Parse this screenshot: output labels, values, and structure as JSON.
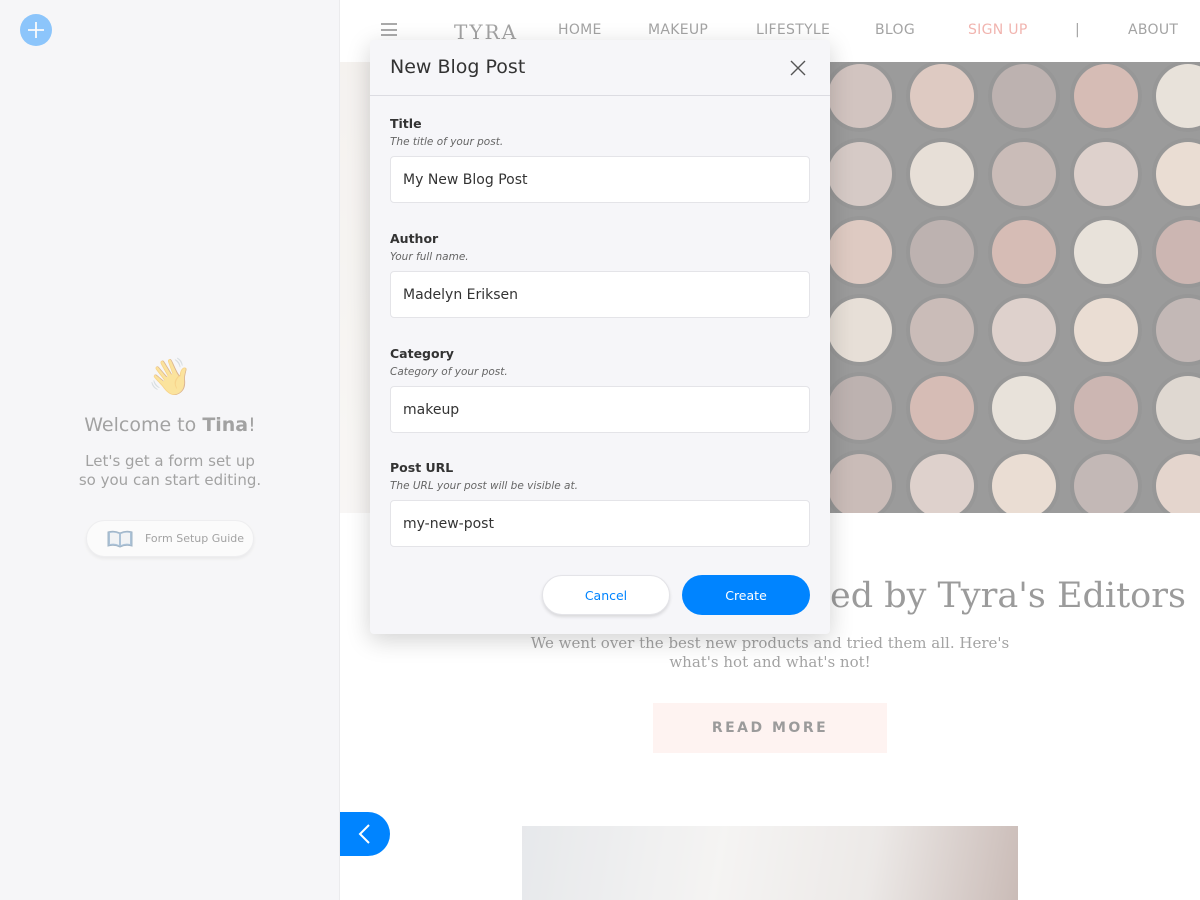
{
  "sidebar": {
    "add_icon": "plus-icon",
    "welcome_emoji": "👋",
    "welcome_prefix": "Welcome to ",
    "welcome_name": "Tina",
    "welcome_suffix": "!",
    "welcome_line1": "Let's get a form set up",
    "welcome_line2": "so you can start editing.",
    "guide_icon": "book-icon",
    "guide_label": "Form Setup Guide",
    "collapse_icon": "chevron-left-icon",
    "accent_color": "#0084ff"
  },
  "site": {
    "logo": "TYRA",
    "nav": [
      {
        "label": "HOME"
      },
      {
        "label": "MAKEUP"
      },
      {
        "label": "LIFESTYLE"
      },
      {
        "label": "BLOG"
      },
      {
        "label": "SIGN UP"
      },
      {
        "label": "|"
      },
      {
        "label": "ABOUT"
      }
    ],
    "signup_color": "#e05a4e",
    "headline_visible": "ed by Tyra's Editors",
    "blurb_line1": "We went over the best new products and tried them all. Here's",
    "blurb_line2": "what's hot and what's not!",
    "read_more": "READ MORE"
  },
  "modal": {
    "title": "New Blog Post",
    "close_icon": "close-icon",
    "fields": [
      {
        "label": "Title",
        "description": "The title of your post.",
        "value": "My New Blog Post"
      },
      {
        "label": "Author",
        "description": "Your full name.",
        "value": "Madelyn Eriksen"
      },
      {
        "label": "Category",
        "description": "Category of your post.",
        "value": "makeup"
      },
      {
        "label": "Post URL",
        "description": "The URL your post will be visible at.",
        "value": "my-new-post"
      }
    ],
    "cancel_label": "Cancel",
    "create_label": "Create"
  }
}
